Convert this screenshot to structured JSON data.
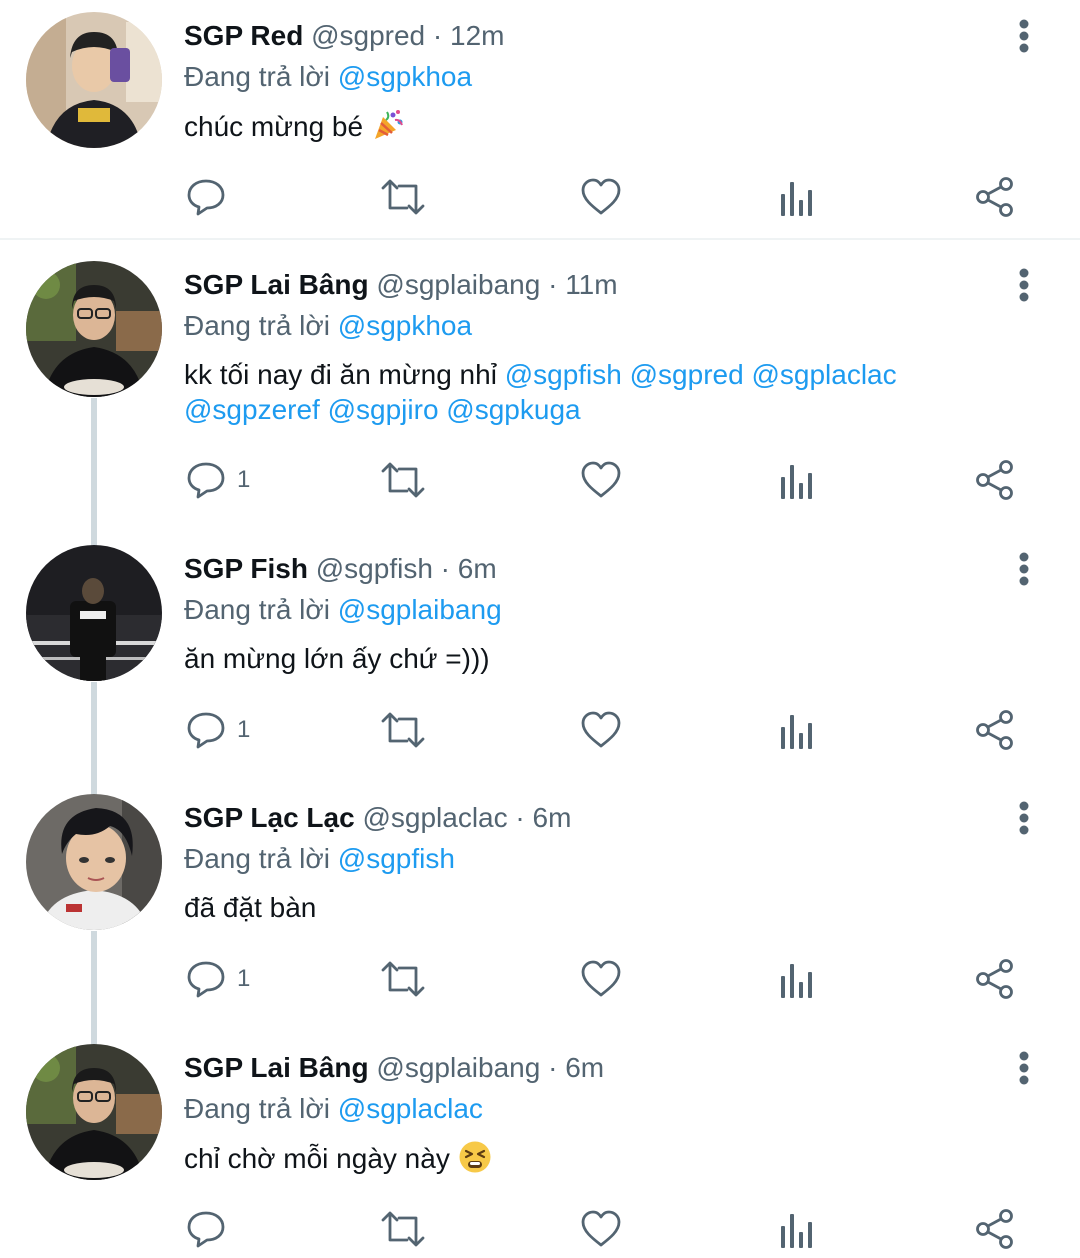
{
  "colors": {
    "link": "#1d9bf0",
    "meta_text": "#536471",
    "thread_line": "#cfd9de",
    "divider": "#eff3f4"
  },
  "reply_prefix": "Đang trả lời",
  "icons": [
    "reply-icon",
    "retweet-icon",
    "like-icon",
    "views-icon",
    "share-icon",
    "more-vertical-icon"
  ],
  "tweets": [
    {
      "name": "SGP Red",
      "handle": "@sgpred",
      "time_sep": " · ",
      "time": "12m",
      "reply_to": "@sgpkhoa",
      "text": "chúc mừng bé",
      "text_emoji": "party-popper",
      "mentions": [],
      "reply_count": ""
    },
    {
      "name": "SGP Lai Bâng",
      "handle": "@sgplaibang",
      "time_sep": " · ",
      "time": "11m",
      "reply_to": "@sgpkhoa",
      "text": "kk tối nay đi ăn mừng nhỉ",
      "mentions": [
        "@sgpfish",
        "@sgpred",
        "@sgplaclac",
        "@sgpzeref",
        "@sgpjiro",
        "@sgpkuga"
      ],
      "reply_count": "1"
    },
    {
      "name": "SGP Fish",
      "handle": "@sgpfish",
      "time_sep": " · ",
      "time": "6m",
      "reply_to": "@sgplaibang",
      "text": "ăn mừng lớn ấy chứ =)))",
      "mentions": [],
      "reply_count": "1"
    },
    {
      "name": "SGP Lạc Lạc",
      "handle": "@sgplaclac",
      "time_sep": " · ",
      "time": "6m",
      "reply_to": "@sgpfish",
      "text": "đã đặt bàn",
      "mentions": [],
      "reply_count": "1"
    },
    {
      "name": "SGP Lai Bâng",
      "handle": "@sgplaibang",
      "time_sep": " · ",
      "time": "6m",
      "reply_to": "@sgplaclac",
      "text": "chỉ chờ mỗi ngày này",
      "text_emoji": "tired-face",
      "mentions": [],
      "reply_count": ""
    }
  ]
}
